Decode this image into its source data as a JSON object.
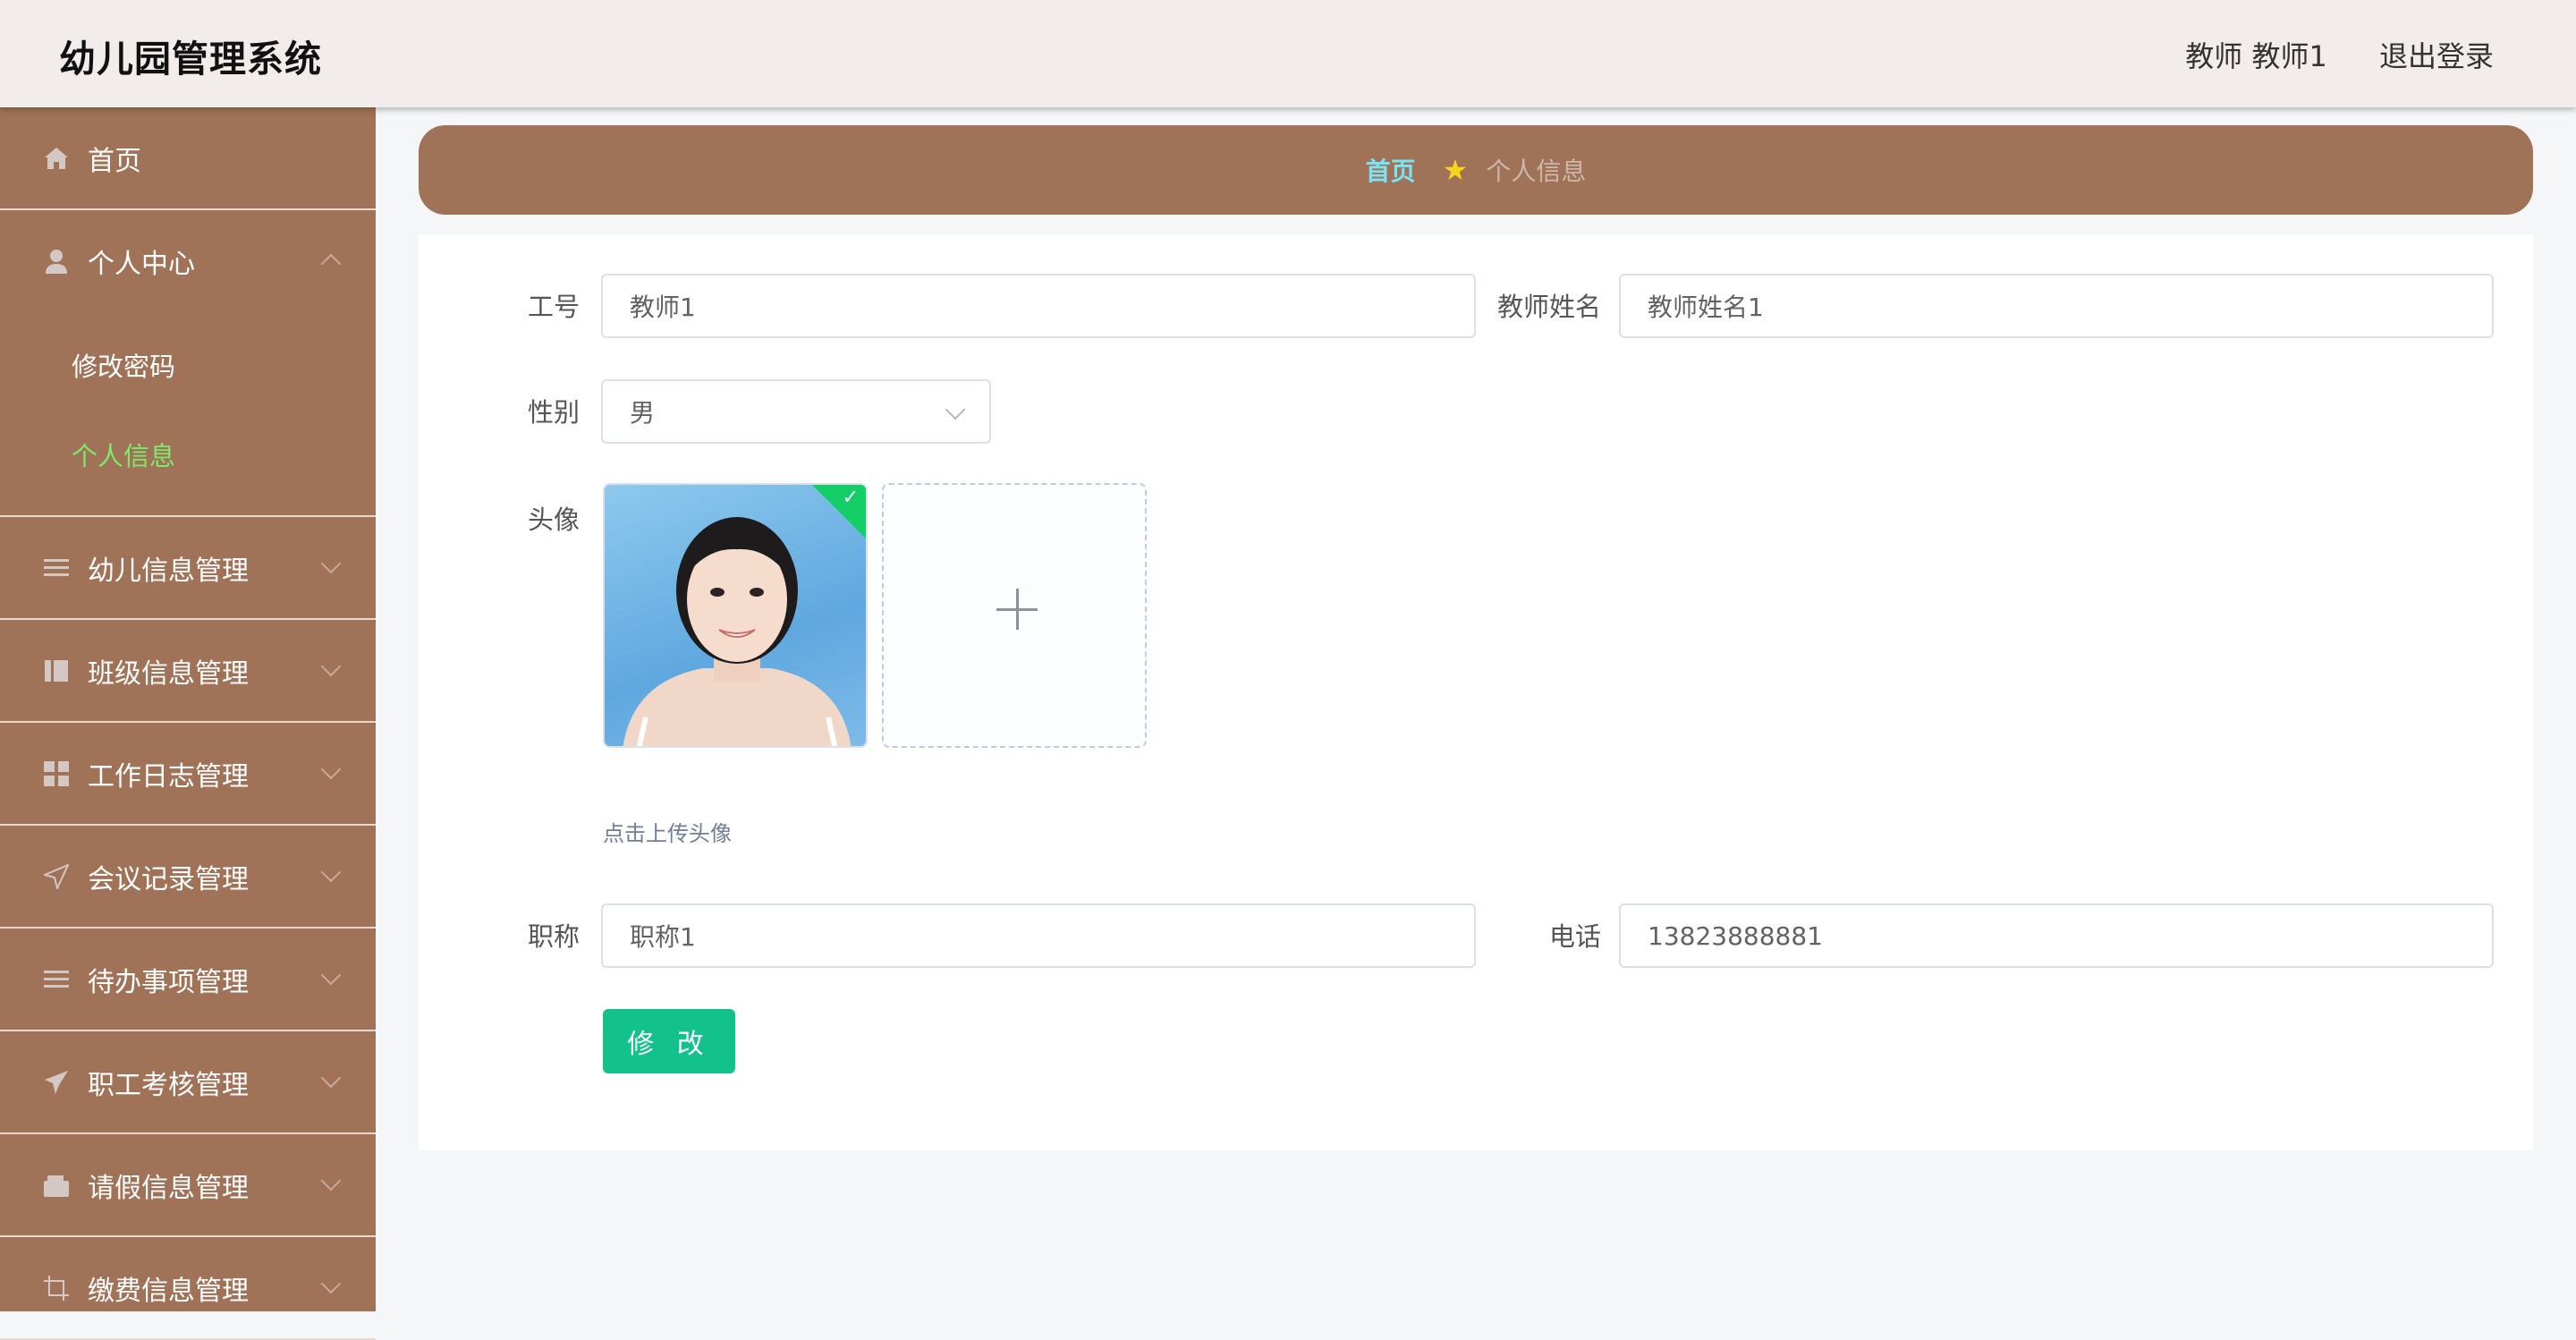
{
  "header": {
    "title": "幼儿园管理系统",
    "user": "教师 教师1",
    "logout": "退出登录"
  },
  "sidebar": {
    "items": [
      {
        "label": "首页",
        "icon": "home-icon"
      },
      {
        "label": "个人中心",
        "icon": "user-icon",
        "children": [
          "修改密码",
          "个人信息"
        ],
        "active_child": "个人信息"
      },
      {
        "label": "幼儿信息管理",
        "icon": "list-icon"
      },
      {
        "label": "班级信息管理",
        "icon": "book-icon"
      },
      {
        "label": "工作日志管理",
        "icon": "grid-icon"
      },
      {
        "label": "会议记录管理",
        "icon": "send-icon"
      },
      {
        "label": "待办事项管理",
        "icon": "list-icon"
      },
      {
        "label": "职工考核管理",
        "icon": "plane-icon"
      },
      {
        "label": "请假信息管理",
        "icon": "wallet-icon"
      },
      {
        "label": "缴费信息管理",
        "icon": "crop-icon"
      }
    ]
  },
  "breadcrumb": {
    "home": "首页",
    "separator_icon": "star-icon",
    "current": "个人信息"
  },
  "form": {
    "employee_no": {
      "label": "工号",
      "value": "教师1"
    },
    "teacher_name": {
      "label": "教师姓名",
      "value": "教师姓名1"
    },
    "gender": {
      "label": "性别",
      "value": "男"
    },
    "avatar": {
      "label": "头像",
      "tip": "点击上传头像"
    },
    "title": {
      "label": "职称",
      "value": "职称1"
    },
    "phone": {
      "label": "电话",
      "value": "13823888881"
    },
    "submit": "修 改"
  },
  "colors": {
    "sidebar": "#a07258",
    "active_sub": "#7dea6a",
    "breadcrumb_home": "#7ae3f4",
    "button": "#12c28a"
  }
}
